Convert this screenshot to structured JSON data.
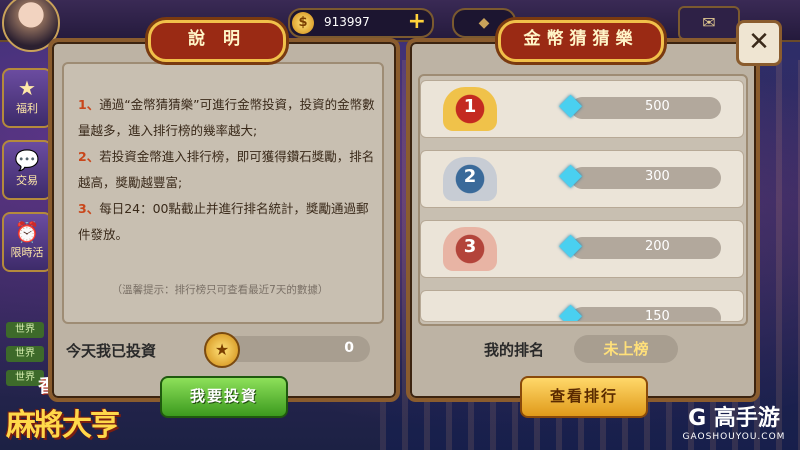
{
  "topbar": {
    "coins": "913997",
    "coin_symbol": "$",
    "plus": "+",
    "diamond_symbol": "◆",
    "mail_symbol": "✉"
  },
  "side": {
    "welfare": "福利",
    "exchange": "交易",
    "limited": "限時活",
    "world_labels": [
      "世界",
      "世界",
      "世界"
    ]
  },
  "logo": {
    "title": "麻將大亨",
    "sub": "香港"
  },
  "left_panel": {
    "title": "說 明",
    "rules": [
      {
        "num": "1、",
        "text": "通過“金幣猜猜樂”可進行金幣投資，投資的金幣數量越多，進入排行榜的幾率越大;"
      },
      {
        "num": "2、",
        "text": "若投資金幣進入排行榜，即可獲得鑽石獎勵，排名越高，獎勵越豐富;"
      },
      {
        "num": "3、",
        "text": "每日24：00點截止并進行排名統計，獎勵通過郵件發放。"
      }
    ],
    "tip": "（溫馨提示：排行榜只可查看最近7天的數據）",
    "invest_label": "今天我已投資",
    "invest_value": "0",
    "invest_button": "我要投資"
  },
  "right_panel": {
    "title": "金幣猜猜樂",
    "ranks": [
      {
        "badge": "1",
        "reward": "500"
      },
      {
        "badge": "2",
        "reward": "300"
      },
      {
        "badge": "3",
        "reward": "200"
      },
      {
        "badge": "",
        "reward": "150"
      }
    ],
    "my_rank_label": "我的排名",
    "my_rank_value": "未上榜",
    "view_button": "查看排行",
    "close_symbol": "✕"
  },
  "watermark": {
    "brand": "G 高手游",
    "url": "GAOSHOUYOU.COM"
  }
}
